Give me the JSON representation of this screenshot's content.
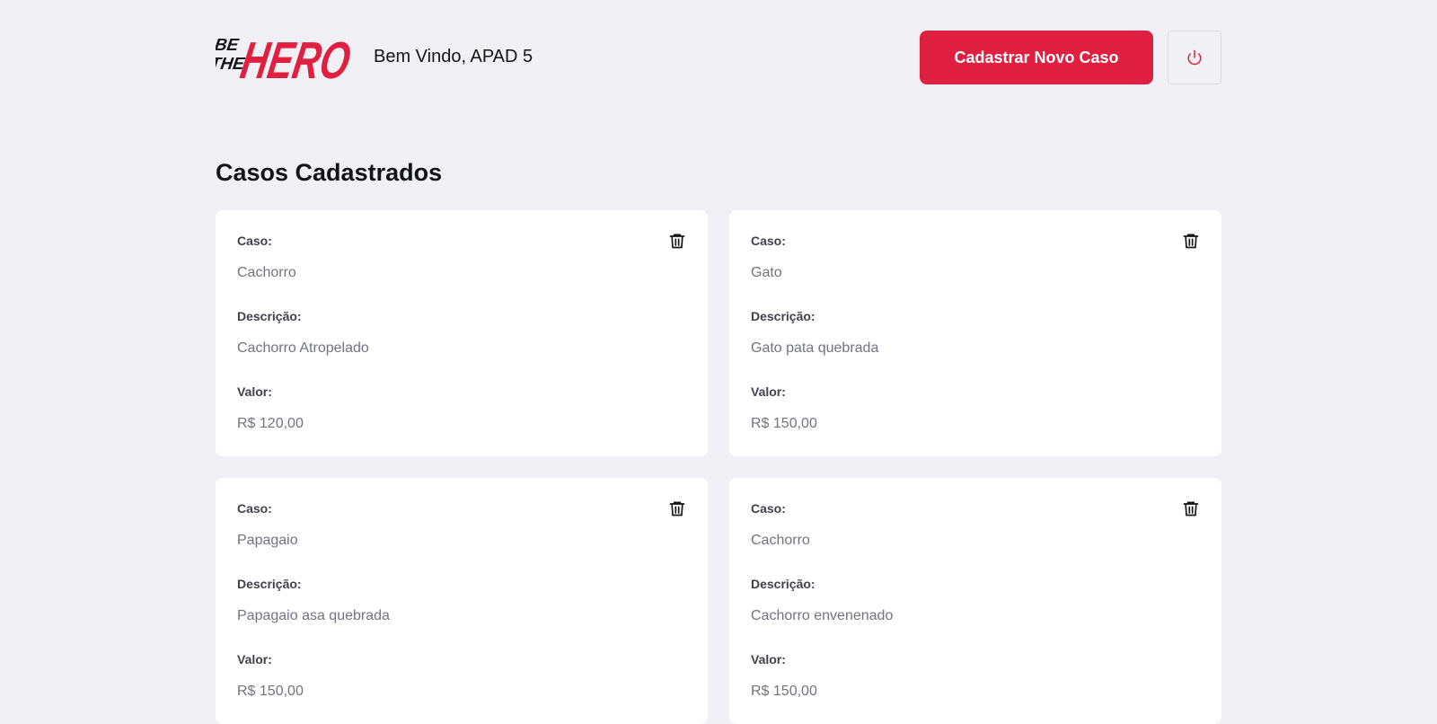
{
  "logo": {
    "alt": "Be The Hero",
    "line1": "BE",
    "line2": "THE",
    "word": "HERO"
  },
  "header": {
    "welcome": "Bem Vindo, APAD 5",
    "new_case_label": "Cadastrar Novo Caso",
    "logout_icon": "power-icon"
  },
  "page": {
    "title": "Casos Cadastrados"
  },
  "labels": {
    "case": "Caso:",
    "description": "Descrição:",
    "value": "Valor:"
  },
  "cases": [
    {
      "title": "Cachorro",
      "description": "Cachorro Atropelado",
      "value": "R$ 120,00"
    },
    {
      "title": "Gato",
      "description": "Gato pata quebrada",
      "value": "R$ 150,00"
    },
    {
      "title": "Papagaio",
      "description": "Papagaio asa quebrada",
      "value": "R$ 150,00"
    },
    {
      "title": "Cachorro",
      "description": "Cachorro envenenado",
      "value": "R$ 150,00"
    }
  ],
  "colors": {
    "brand": "#e02041",
    "background": "#f0f0f5",
    "card": "#ffffff",
    "label": "#41414d",
    "value": "#737380"
  }
}
